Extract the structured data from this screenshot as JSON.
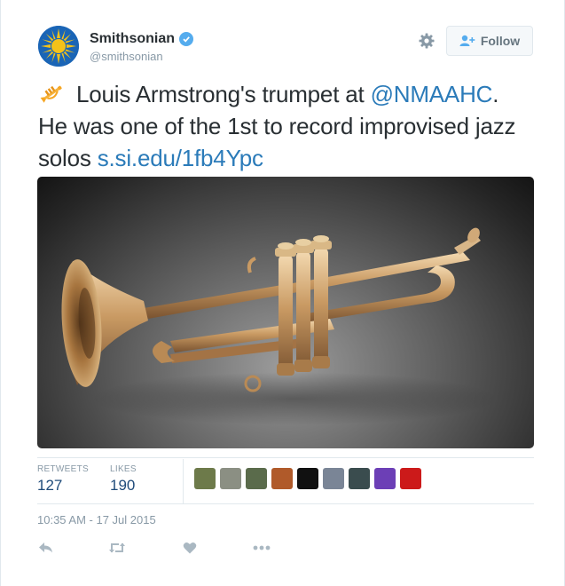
{
  "user": {
    "name": "Smithsonian",
    "handle": "@smithsonian"
  },
  "follow_button": {
    "label": "Follow"
  },
  "tweet": {
    "text_part1": " Louis Armstrong's trumpet at ",
    "mention": "@NMAAHC",
    "text_part2": ".",
    "text_line2": "He was one of the 1st to record improvised jazz",
    "text_line3": "solos ",
    "link": "s.si.edu/1fb4Ypc",
    "emoji": "trumpet-emoji"
  },
  "stats": {
    "retweets_label": "RETWEETS",
    "retweets": "127",
    "likes_label": "LIKES",
    "likes": "190"
  },
  "liker_avatars": [
    {
      "color": "#6d7a4a"
    },
    {
      "color": "#8b8f83"
    },
    {
      "color": "#5a6b4b"
    },
    {
      "color": "#b05a2a"
    },
    {
      "color": "#111111"
    },
    {
      "color": "#7a8596"
    },
    {
      "color": "#3a4c4e"
    },
    {
      "color": "#6c3fb6"
    },
    {
      "color": "#cc1a1a"
    }
  ],
  "timestamp": "10:35 AM - 17 Jul 2015",
  "icons": [
    "reply-icon",
    "retweet-icon",
    "like-icon",
    "more-icon",
    "gear-icon",
    "verified-icon",
    "add-user-icon"
  ],
  "colors": {
    "link": "#2b7bb9",
    "avatar_bg": "#1a65b6",
    "verified": "#55acee"
  }
}
